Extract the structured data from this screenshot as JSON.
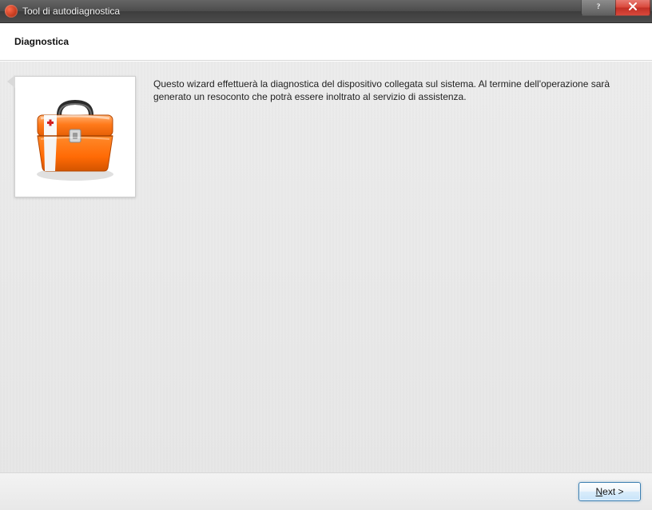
{
  "window": {
    "title": "Tool di autodiagnostica"
  },
  "header": {
    "title": "Diagnostica"
  },
  "content": {
    "description": "Questo wizard effettuerà la diagnostica del dispositivo collegata sul sistema. Al termine dell'operazione sarà generato un resoconto che potrà essere inoltrato al servizio di assistenza.",
    "illustration": "toolbox-icon"
  },
  "footer": {
    "next_hotkey": "N",
    "next_rest": "ext >"
  }
}
